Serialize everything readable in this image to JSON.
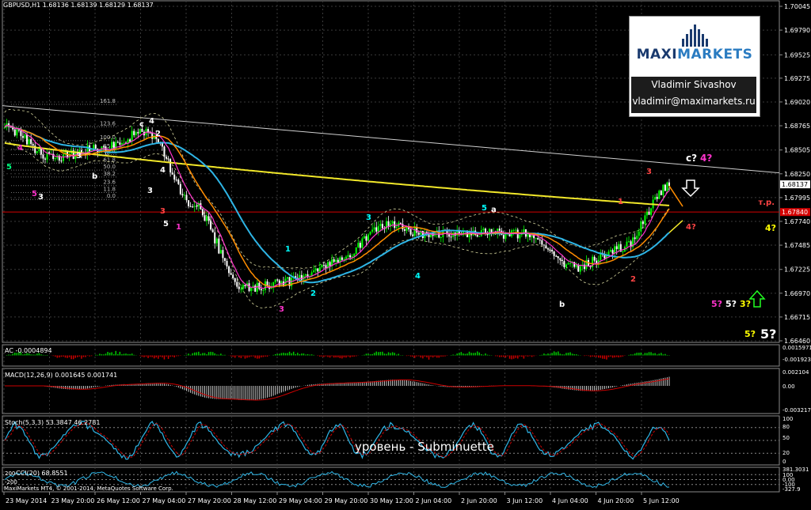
{
  "header": {
    "symbol_info": "GBPUSD,H1  1.68136 1.68139 1.68129 1.68137"
  },
  "logo": {
    "brand_maxi": "MAXI",
    "brand_markets": "MARKETS",
    "author_name": "Vladimir Sivashov",
    "author_email": "vladimir@maximarkets.ru"
  },
  "colors": {
    "background": "#000000",
    "candle_bull": "#00ff00",
    "candle_bear": "#ffffff",
    "ma_slow": "#f2e82a",
    "ma_mid": "#2eb5e6",
    "ma_orange": "#ff8c00",
    "ma_magenta": "#ff33cc",
    "level_red": "#d40000",
    "trend": "#d0d0d0"
  },
  "main_panel": {
    "price_axis": [
      "1.70045",
      "1.69790",
      "1.69525",
      "1.69275",
      "1.69020",
      "1.68765",
      "1.68505",
      "1.68250",
      "1.67995",
      "1.67740",
      "1.67485",
      "1.67225",
      "1.66970",
      "1.66715",
      "1.66460"
    ],
    "fib_levels": [
      "161.8",
      "123.6",
      "100.0",
      "85.4",
      "76.4",
      "61.8",
      "50.0",
      "38.2",
      "23.6",
      "11.8",
      "0.0"
    ],
    "current_price": "1.68137",
    "red_level_price": "1.67840",
    "red_level_label": "т.р.",
    "wave_labels": [
      {
        "text": "5",
        "color": "#00ff7f"
      },
      {
        "text": "4",
        "color": "#ff33cc"
      },
      {
        "text": "3",
        "color": "#ffffff"
      },
      {
        "text": "5",
        "color": "#ff33cc"
      },
      {
        "text": "3",
        "color": "#ffffff"
      },
      {
        "text": "b",
        "color": "#ffffff"
      },
      {
        "text": "c",
        "color": "#ffffff"
      },
      {
        "text": "4",
        "color": "#ffffff"
      },
      {
        "text": "2",
        "color": "#ffffff"
      },
      {
        "text": "3",
        "color": "#ffffff"
      },
      {
        "text": "4",
        "color": "#ffffff"
      },
      {
        "text": "3",
        "color": "#ff4444"
      },
      {
        "text": "5",
        "color": "#ffffff"
      },
      {
        "text": "1",
        "color": "#ff33cc"
      },
      {
        "text": "1",
        "color": "#00ffff"
      },
      {
        "text": "2",
        "color": "#00ffff"
      },
      {
        "text": "3",
        "color": "#ff33cc"
      },
      {
        "text": "3",
        "color": "#00ffff"
      },
      {
        "text": "4",
        "color": "#00ffff"
      },
      {
        "text": "5",
        "color": "#00ffff"
      },
      {
        "text": "a",
        "color": "#ffffff"
      },
      {
        "text": "b",
        "color": "#ffffff"
      },
      {
        "text": "1",
        "color": "#ff4444"
      },
      {
        "text": "2",
        "color": "#ff4444"
      },
      {
        "text": "3",
        "color": "#ff4444"
      }
    ],
    "right_annotations": [
      {
        "text": "c?",
        "color": "#ffffff"
      },
      {
        "text": "4?",
        "color": "#ff33cc"
      },
      {
        "text": "4?",
        "color": "#ff4444"
      },
      {
        "text": "4?",
        "color": "#ffff00"
      },
      {
        "text": "5?",
        "color": "#ff33cc"
      },
      {
        "text": "5?",
        "color": "#ffffff"
      },
      {
        "text": "3?",
        "color": "#ffff00"
      },
      {
        "text": "5?",
        "color": "#ffff00"
      },
      {
        "text": "5?",
        "color": "#ffffff"
      }
    ]
  },
  "ac_panel": {
    "label": "AC -0.0004894",
    "axis": [
      "0.0015971",
      "-0.0019235"
    ]
  },
  "macd_panel": {
    "label": "MACD(12,26,9) 0.001645 0.001741",
    "axis": [
      "0.002104",
      "0.00",
      "-0.003217"
    ]
  },
  "stoch_panel": {
    "label": "Stoch(5,3,3) 53.3847 46.2781",
    "axis": [
      "100",
      "80",
      "50",
      "20",
      "0"
    ],
    "overlay_text": "уровень - Subminuette"
  },
  "cci_panel": {
    "label": "CCI(20) 68.8551",
    "left_label": "200",
    "left_label2": "-200",
    "axis": [
      "381.3031",
      "100",
      "0.00",
      "-100",
      "-327.9"
    ]
  },
  "copyright": "MaxiMarkets MT4, © 2001-2014, MetaQuotes Software Corp.",
  "time_axis": [
    "23 May 2014",
    "23 May 20:00",
    "26 May 12:00",
    "27 May 04:00",
    "27 May 20:00",
    "28 May 12:00",
    "29 May 04:00",
    "29 May 20:00",
    "30 May 12:00",
    "2 Jun 04:00",
    "2 Jun 20:00",
    "3 Jun 12:00",
    "4 Jun 04:00",
    "4 Jun 20:00",
    "5 Jun 12:00"
  ],
  "chart_data": {
    "type": "line",
    "title": "GBPUSD,H1",
    "xlabel": "",
    "ylabel": "",
    "ylim": [
      1.6646,
      1.70045
    ],
    "x": [
      "23 May 2014",
      "23 May 20:00",
      "26 May 12:00",
      "27 May 04:00",
      "27 May 20:00",
      "28 May 12:00",
      "29 May 04:00",
      "29 May 20:00",
      "30 May 12:00",
      "2 Jun 04:00",
      "2 Jun 20:00",
      "3 Jun 12:00",
      "4 Jun 04:00",
      "4 Jun 20:00",
      "5 Jun 12:00"
    ],
    "series": [
      {
        "values": [
          1.6875,
          1.6842,
          1.6852,
          1.687,
          1.679,
          1.6702,
          1.671,
          1.673,
          1.677,
          1.676,
          1.6762,
          1.676,
          1.6725,
          1.6745,
          1.6812
        ]
      }
    ],
    "grid": true,
    "legend": "none"
  }
}
